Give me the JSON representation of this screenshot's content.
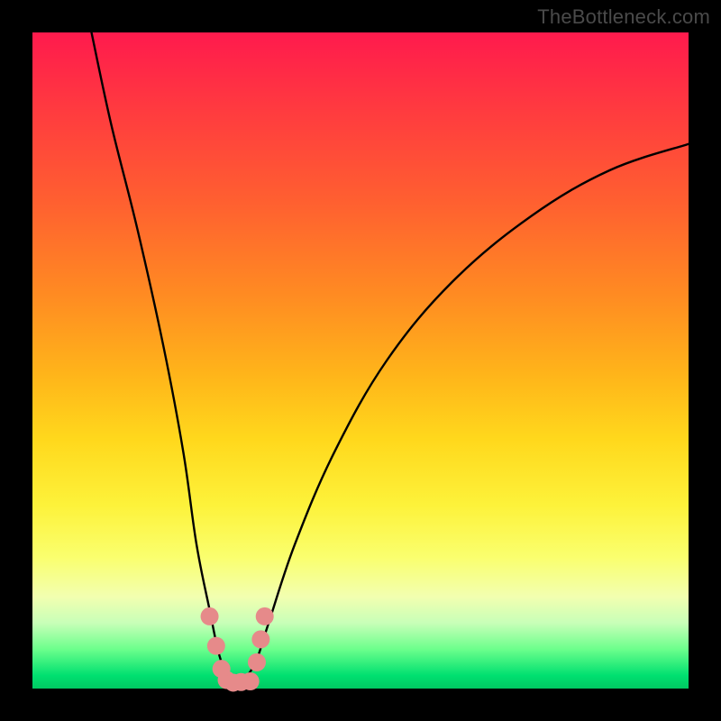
{
  "watermark": "TheBottleneck.com",
  "chart_data": {
    "type": "line",
    "title": "",
    "xlabel": "",
    "ylabel": "",
    "xlim": [
      0,
      100
    ],
    "ylim": [
      0,
      100
    ],
    "series": [
      {
        "name": "bottleneck-curve",
        "x": [
          9,
          12,
          16,
          20,
          23,
          25,
          27,
          28.5,
          30,
          31,
          32,
          34,
          36,
          40,
          46,
          54,
          64,
          76,
          88,
          100
        ],
        "values": [
          100,
          86,
          70,
          52,
          36,
          22,
          12,
          5,
          1.5,
          0.8,
          1.2,
          4,
          10,
          22,
          36,
          50,
          62,
          72,
          79,
          83
        ]
      }
    ],
    "markers": {
      "name": "highlight-dots",
      "color": "#e68a8a",
      "points": [
        {
          "x": 27.0,
          "y": 11.0
        },
        {
          "x": 28.0,
          "y": 6.5
        },
        {
          "x": 28.8,
          "y": 3.0
        },
        {
          "x": 29.6,
          "y": 1.3
        },
        {
          "x": 30.6,
          "y": 0.9
        },
        {
          "x": 31.8,
          "y": 1.0
        },
        {
          "x": 33.2,
          "y": 1.1
        },
        {
          "x": 34.2,
          "y": 4.0
        },
        {
          "x": 34.8,
          "y": 7.5
        },
        {
          "x": 35.4,
          "y": 11.0
        }
      ]
    }
  }
}
